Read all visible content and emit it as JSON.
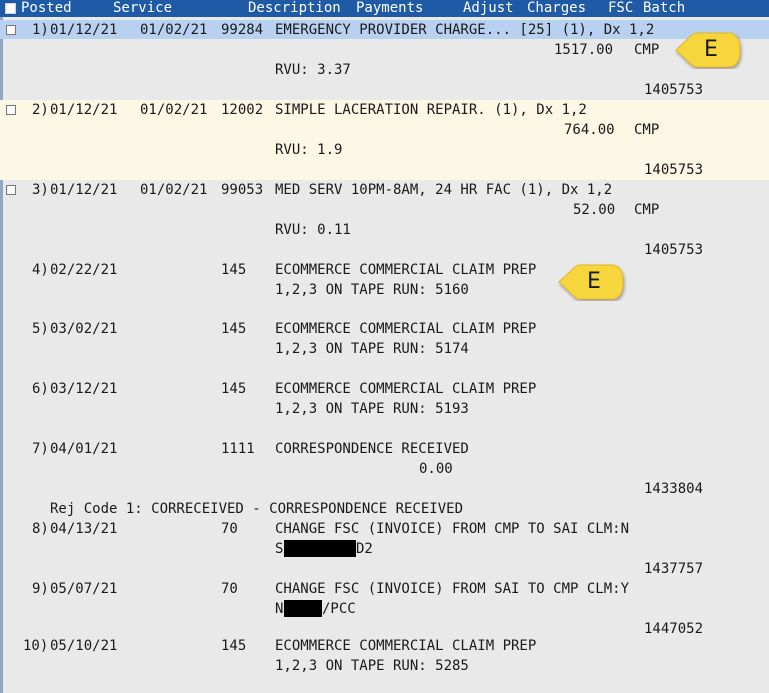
{
  "header": {
    "select_all_checked": false,
    "columns": {
      "posted": "Posted",
      "service": "Service",
      "description": "Description",
      "payments": "Payments",
      "adjust": "Adjust",
      "charges": "Charges",
      "fsc": "FSC",
      "batch": "Batch"
    }
  },
  "colors": {
    "header_bg": "#1f5aa6",
    "selected_row_bg": "#b9d1f0",
    "highlight_row_bg": "#fdf7e6",
    "page_bg": "#e9e9e9",
    "badge_fill": "#f7d63c"
  },
  "rows": [
    {
      "num": "1)",
      "posted": "01/12/21",
      "service": "01/02/21",
      "code": "99284",
      "desc": "EMERGENCY PROVIDER CHARGE... [25] (1), Dx 1,2",
      "charges": "1517.00",
      "fsc": "CMP",
      "rvu": "RVU: 3.37",
      "batch": "1405753"
    },
    {
      "num": "2)",
      "posted": "01/12/21",
      "service": "01/02/21",
      "code": "12002",
      "desc": "SIMPLE LACERATION REPAIR. (1), Dx 1,2",
      "charges": "764.00",
      "fsc": "CMP",
      "rvu": "RVU: 1.9",
      "batch": "1405753"
    },
    {
      "num": "3)",
      "posted": "01/12/21",
      "service": "01/02/21",
      "code": "99053",
      "desc": "MED SERV 10PM-8AM, 24 HR FAC (1), Dx 1,2",
      "charges": "52.00",
      "fsc": "CMP",
      "rvu": "RVU: 0.11",
      "batch": "1405753"
    },
    {
      "num": "4)",
      "posted": "02/22/21",
      "code": "145",
      "desc": "ECOMMERCE COMMERCIAL CLAIM PREP",
      "desc2": "1,2,3 ON TAPE RUN: 5160"
    },
    {
      "num": "5)",
      "posted": "03/02/21",
      "code": "145",
      "desc": "ECOMMERCE COMMERCIAL CLAIM PREP",
      "desc2": "1,2,3 ON TAPE RUN: 5174"
    },
    {
      "num": "6)",
      "posted": "03/12/21",
      "code": "145",
      "desc": "ECOMMERCE COMMERCIAL CLAIM PREP",
      "desc2": "1,2,3 ON TAPE RUN: 5193"
    },
    {
      "num": "7)",
      "posted": "04/01/21",
      "code": "1111",
      "desc": "CORRESPONDENCE RECEIVED",
      "payments": "0.00",
      "batch": "1433804",
      "rej": "Rej Code 1: CORRECEIVED - CORRESPONDENCE RECEIVED"
    },
    {
      "num": "8)",
      "posted": "04/13/21",
      "code": "70",
      "desc": "CHANGE FSC (INVOICE) FROM CMP TO SAI CLM:N",
      "desc2_pre": "S",
      "desc2_post": "D2",
      "batch": "1437757"
    },
    {
      "num": "9)",
      "posted": "05/07/21",
      "code": "70",
      "desc": "CHANGE FSC (INVOICE) FROM SAI TO CMP CLM:Y",
      "desc2_pre": "N",
      "desc2_post": "/PCC",
      "batch": "1447052"
    },
    {
      "num": "10)",
      "posted": "05/10/21",
      "code": "145",
      "desc": "ECOMMERCE COMMERCIAL CLAIM PREP",
      "desc2": "1,2,3 ON TAPE RUN: 5285"
    }
  ],
  "badges": [
    {
      "letter": "E",
      "icon": "e-badge-icon"
    },
    {
      "letter": "E",
      "icon": "e-badge-icon"
    }
  ]
}
